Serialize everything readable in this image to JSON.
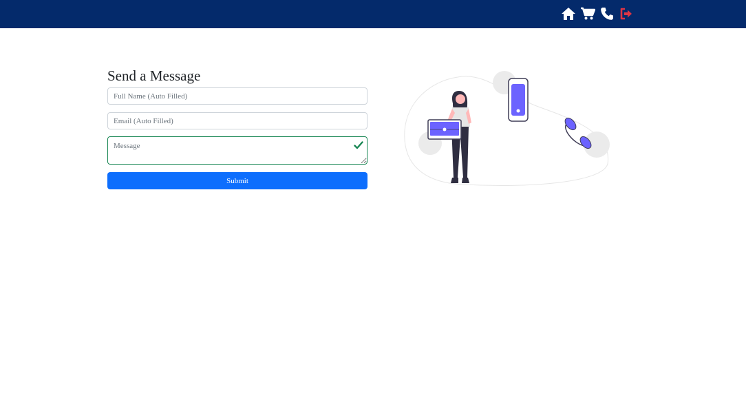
{
  "navbar": {
    "background": "#042a6b",
    "icons": [
      {
        "name": "home-icon",
        "color": "#ffffff"
      },
      {
        "name": "cart-icon",
        "color": "#ffffff"
      },
      {
        "name": "phone-icon",
        "color": "#ffffff"
      },
      {
        "name": "logout-icon",
        "color": "#dc3545"
      }
    ]
  },
  "form": {
    "title": "Send a Message",
    "name_placeholder": "Full Name (Auto Filled)",
    "email_placeholder": "Email (Auto Filled)",
    "message_placeholder": "Message",
    "submit_label": "Submit",
    "accent_color": "#0d6efd",
    "valid_color": "#198754"
  },
  "illustration": {
    "accent_color": "#6c63ff"
  }
}
